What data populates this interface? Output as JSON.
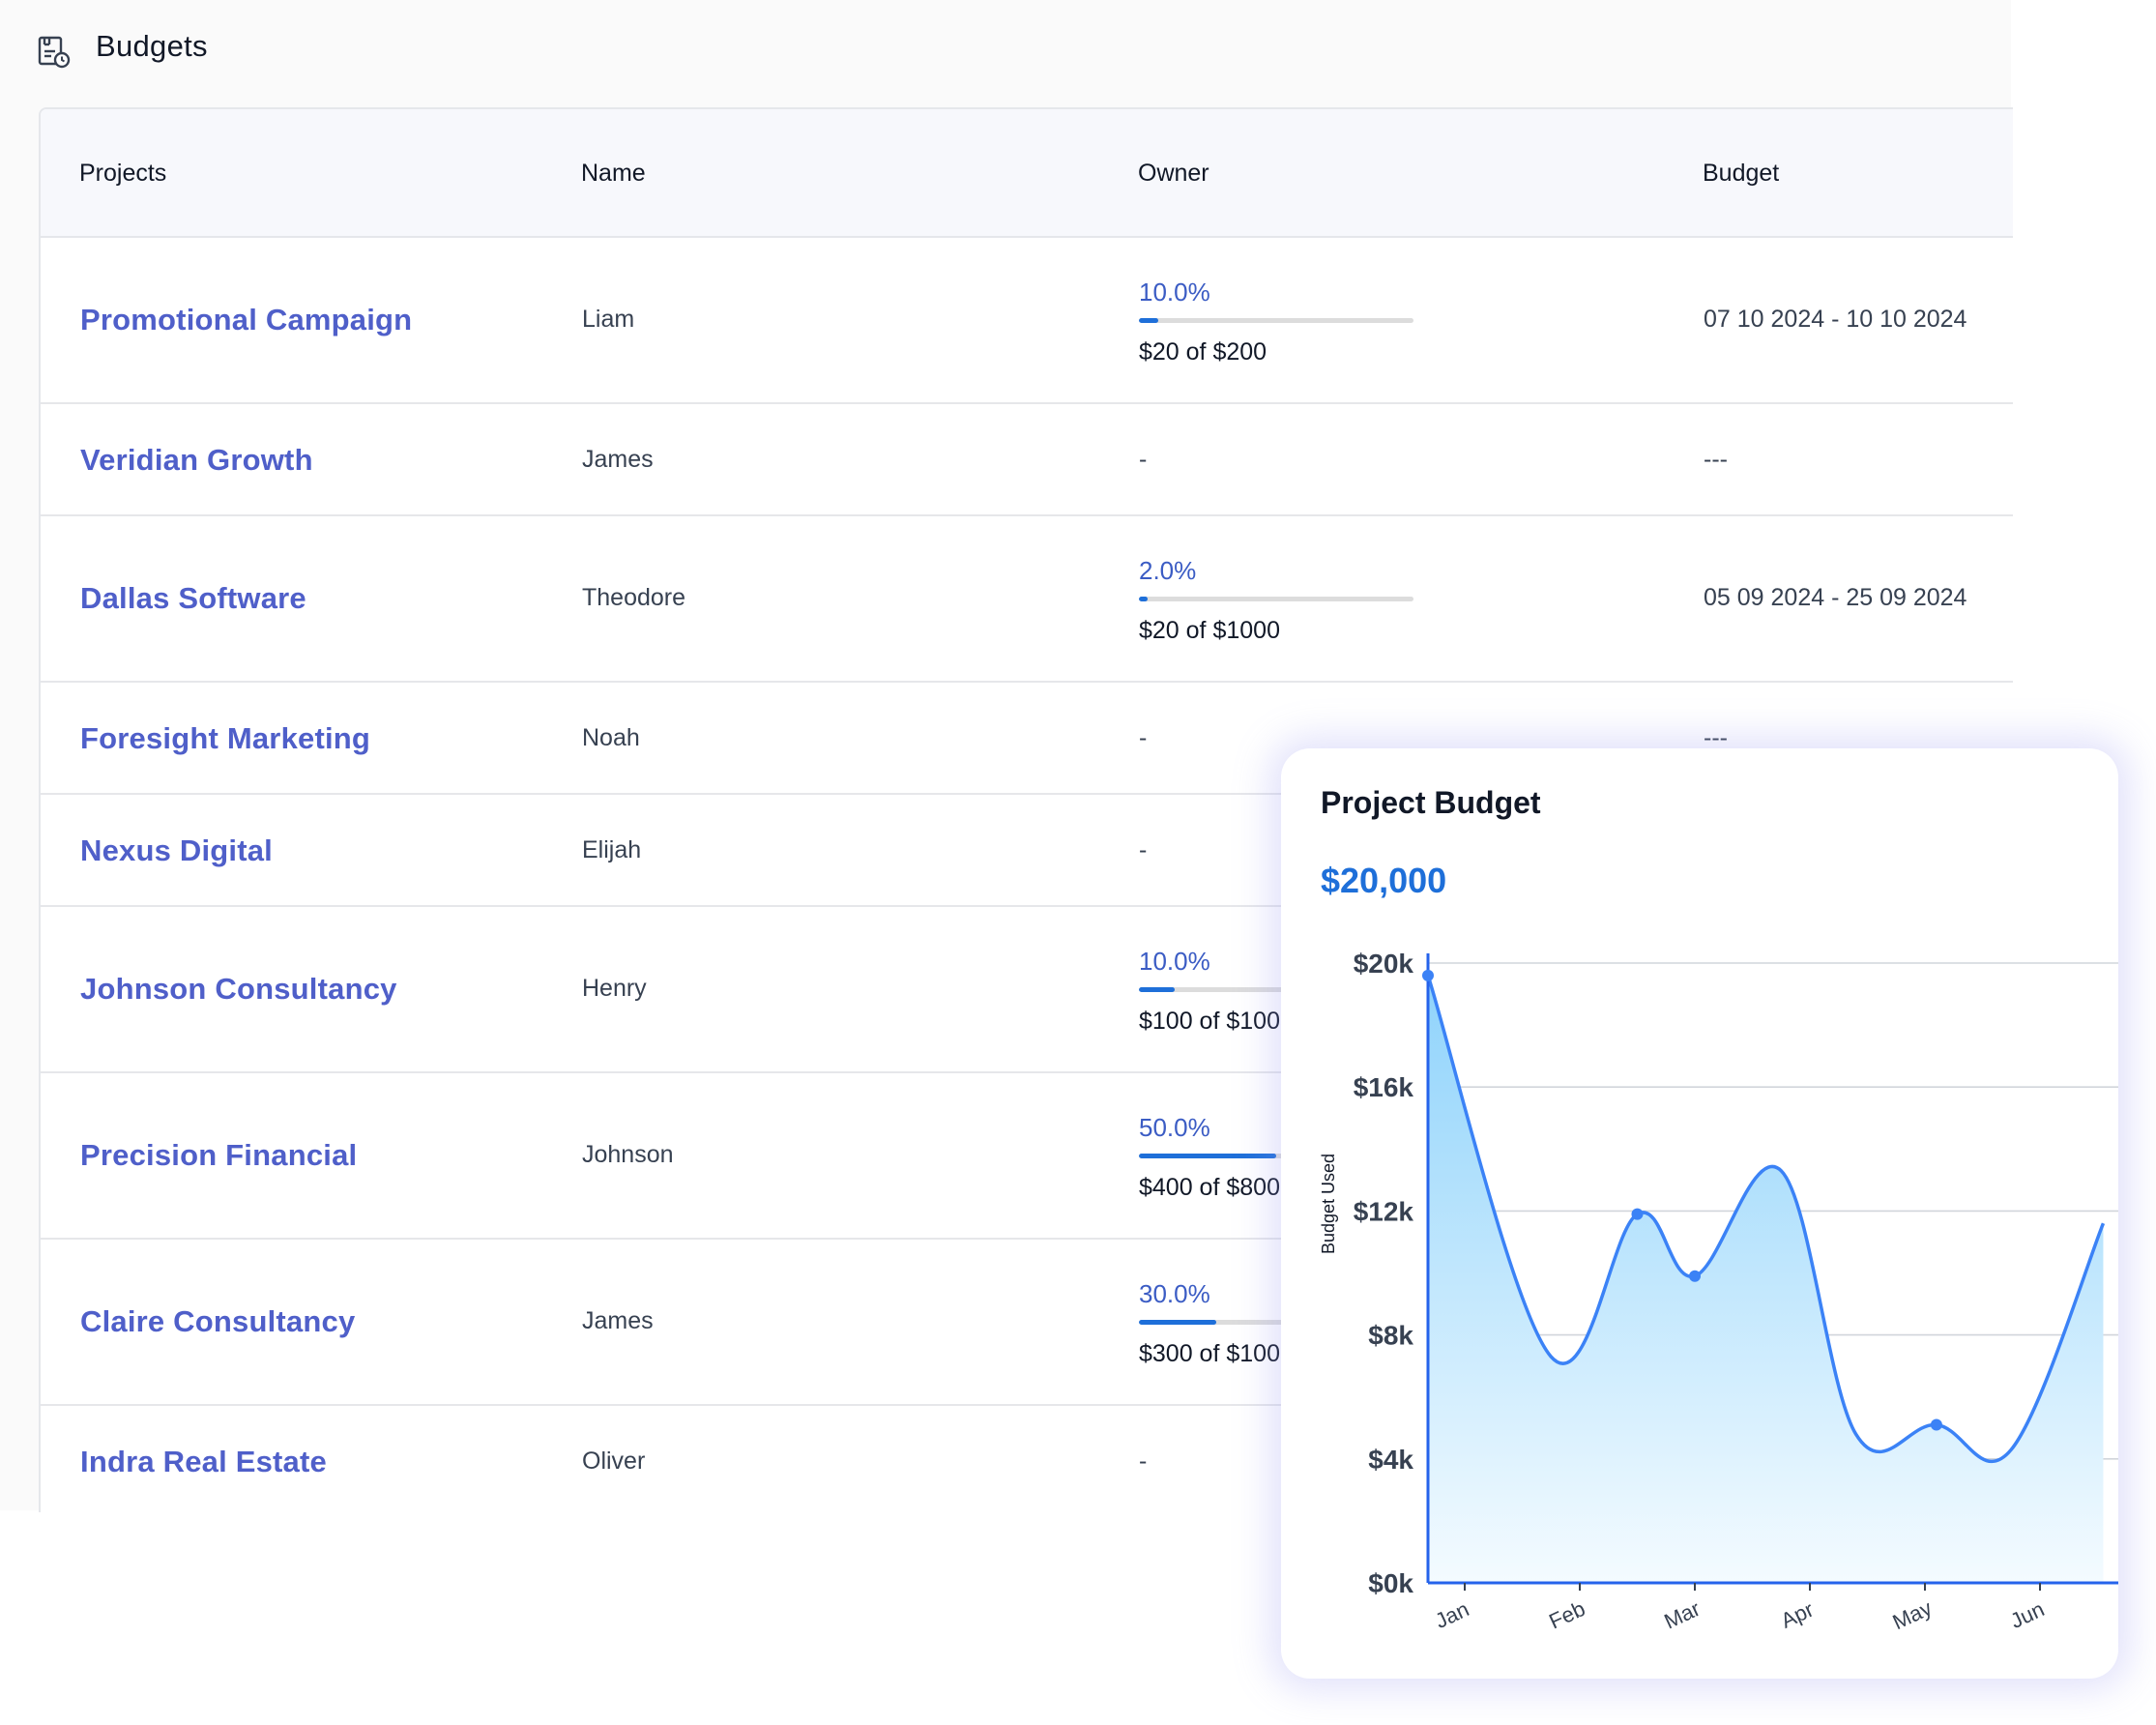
{
  "header": {
    "title": "Budgets",
    "icon": "budget-report-icon"
  },
  "table": {
    "columns": [
      "Projects",
      "Name",
      "Owner",
      "Budget"
    ],
    "rows": [
      {
        "project": "Promotional Campaign",
        "name": "Liam",
        "owner": {
          "percent": "10.0%",
          "progress": 0.1,
          "amount": "$20 of $200"
        },
        "budget": "07 10 2024 - 10 10 2024"
      },
      {
        "project": "Veridian Growth",
        "name": "James",
        "owner_dash": "-",
        "budget": "---"
      },
      {
        "project": "Dallas Software",
        "name": "Theodore",
        "owner": {
          "percent": "2.0%",
          "progress": 0.02,
          "amount": "$20 of $1000"
        },
        "budget": "05 09 2024 - 25 09 2024"
      },
      {
        "project": "Foresight Marketing",
        "name": "Noah",
        "owner_dash": "-",
        "budget": "---"
      },
      {
        "project": "Nexus Digital",
        "name": "Elijah",
        "owner_dash": "-"
      },
      {
        "project": "Johnson Consultancy",
        "name": "Henry",
        "owner": {
          "percent": "10.0%",
          "progress": 0.1,
          "amount": "$100 of $100"
        }
      },
      {
        "project": "Precision Financial",
        "name": "Johnson",
        "owner": {
          "percent": "50.0%",
          "progress": 0.5,
          "amount": "$400 of $800"
        }
      },
      {
        "project": "Claire Consultancy",
        "name": "James",
        "owner": {
          "percent": "30.0%",
          "progress": 0.3,
          "amount": "$300 of $100"
        }
      },
      {
        "project": "Indra Real Estate",
        "name": "Oliver",
        "owner_dash": "-"
      }
    ]
  },
  "card": {
    "title": "Project Budget",
    "total": "$20,000"
  },
  "chart_data": {
    "type": "area",
    "ylabel": "Budget Used",
    "y_ticks": [
      "$0k",
      "$4k",
      "$8k",
      "$12k",
      "$16k",
      "$20k"
    ],
    "y_tick_values": [
      0,
      4000,
      8000,
      12000,
      16000,
      20000
    ],
    "ylim": [
      0,
      20000
    ],
    "x_ticks": [
      "Jan",
      "Feb",
      "Mar",
      "Apr",
      "May",
      "Jun"
    ],
    "x": [
      0,
      0.75,
      1.5,
      2.0,
      2.75,
      3.4,
      4.1,
      4.75,
      5.55
    ],
    "values": [
      19600,
      7300,
      11900,
      9900,
      13300,
      4800,
      5100,
      4300,
      11600
    ],
    "markers": [
      0,
      2,
      3,
      6
    ],
    "colors": {
      "line": "#3b82f6",
      "fill_top": "#8fd3fb",
      "fill_bottom": "#f4fbff",
      "grid": "#d1d5db",
      "axis": "#2563eb"
    },
    "grid": true
  }
}
